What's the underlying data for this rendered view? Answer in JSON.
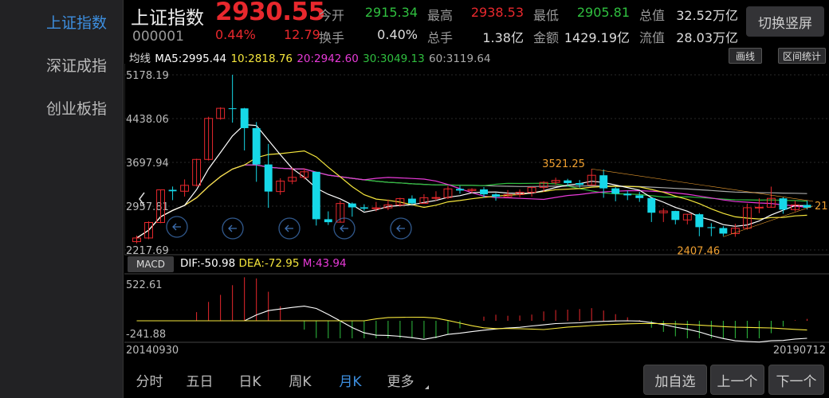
{
  "sidebar": {
    "items": [
      {
        "label": "上证指数",
        "active": true
      },
      {
        "label": "深证成指",
        "active": false
      },
      {
        "label": "创业板指",
        "active": false
      }
    ]
  },
  "header": {
    "name": "上证指数",
    "code": "000001",
    "price": "2930.55",
    "change_pct": "0.44%",
    "change_amt": "12.79",
    "quotes": [
      {
        "label": "今开",
        "value": "2915.34",
        "color": "#2fbf3f"
      },
      {
        "label": "最高",
        "value": "2938.53",
        "color": "#e8282d"
      },
      {
        "label": "最低",
        "value": "2905.81",
        "color": "#2fbf3f"
      },
      {
        "label": "总值",
        "value": "32.52万亿",
        "color": "#dddddd"
      },
      {
        "label": "换手",
        "value": "0.40%",
        "color": "#dddddd"
      },
      {
        "label": "总手",
        "value": "1.38亿",
        "color": "#dddddd"
      },
      {
        "label": "金额",
        "value": "1429.19亿",
        "color": "#dddddd"
      },
      {
        "label": "流值",
        "value": "28.03万亿",
        "color": "#dddddd"
      }
    ],
    "switch_label": "切换竖屏"
  },
  "ma_legend": {
    "title": "均线",
    "ma5": "MA5:2995.44",
    "ma10": "10:2818.76",
    "ma20": "20:2942.60",
    "ma30": "30:3049.13",
    "ma60": "60:3119.64"
  },
  "toolbar": {
    "draw_label": "画线",
    "range_label": "区间统计"
  },
  "colors": {
    "up": "#e8282d",
    "down": "#16d8e8",
    "ma5": "#ffffff",
    "ma10": "#f5e63c",
    "ma20": "#e83ad8",
    "ma30": "#2fbf3f",
    "ma60": "#aaaaaa",
    "accent": "#3d8fe0"
  },
  "chart_data": {
    "type": "candlestick",
    "period": "monthly",
    "y_ticks": [
      "5178.19",
      "4438.06",
      "3697.94",
      "2957.81",
      "2217.69"
    ],
    "ylim": [
      2217.69,
      5178.19
    ],
    "annotations": {
      "high_label": "3521.25",
      "low_label": "2407.46",
      "right_label": "21"
    },
    "candles": [
      [
        2358,
        2420,
        2330,
        2460
      ],
      [
        2420,
        2682,
        2400,
        2700
      ],
      [
        2682,
        3234,
        2670,
        3240
      ],
      [
        3234,
        3210,
        3060,
        3290
      ],
      [
        3210,
        3310,
        3120,
        3410
      ],
      [
        3310,
        3748,
        3290,
        3760
      ],
      [
        3748,
        4441,
        3730,
        4470
      ],
      [
        4441,
        4612,
        4420,
        4630
      ],
      [
        4612,
        4611,
        4370,
        5178
      ],
      [
        4611,
        4277,
        3900,
        4620
      ],
      [
        4277,
        3663,
        3370,
        4380
      ],
      [
        3663,
        3205,
        2930,
        4010
      ],
      [
        3205,
        3382,
        3150,
        3430
      ],
      [
        3382,
        3445,
        3330,
        3610
      ],
      [
        3445,
        3539,
        3410,
        3600
      ],
      [
        3539,
        2737,
        2630,
        3540
      ],
      [
        2737,
        2687,
        2640,
        2870
      ],
      [
        2687,
        3003,
        2680,
        3050
      ],
      [
        3003,
        2938,
        2780,
        3020
      ],
      [
        2938,
        2916,
        2880,
        2990
      ],
      [
        2916,
        2929,
        2870,
        3030
      ],
      [
        2929,
        2979,
        2890,
        3070
      ],
      [
        2979,
        3085,
        2950,
        3100
      ],
      [
        3085,
        3004,
        2990,
        3140
      ],
      [
        3004,
        3100,
        3000,
        3160
      ],
      [
        3100,
        3104,
        3050,
        3210
      ],
      [
        3104,
        3250,
        3080,
        3300
      ],
      [
        3250,
        3222,
        3170,
        3300
      ],
      [
        3222,
        3241,
        3180,
        3260
      ],
      [
        3241,
        3158,
        3100,
        3280
      ],
      [
        3158,
        3117,
        3050,
        3180
      ],
      [
        3117,
        3154,
        3110,
        3230
      ],
      [
        3154,
        3193,
        3110,
        3240
      ],
      [
        3193,
        3273,
        3120,
        3290
      ],
      [
        3273,
        3360,
        3200,
        3380
      ],
      [
        3360,
        3393,
        3320,
        3440
      ],
      [
        3393,
        3348,
        3300,
        3420
      ],
      [
        3348,
        3317,
        3270,
        3400
      ],
      [
        3317,
        3480,
        3310,
        3587
      ],
      [
        3480,
        3259,
        3100,
        3580
      ],
      [
        3259,
        3168,
        3040,
        3280
      ],
      [
        3168,
        3141,
        3060,
        3220
      ],
      [
        3141,
        3095,
        3030,
        3200
      ],
      [
        3095,
        2847,
        2690,
        3100
      ],
      [
        2847,
        2876,
        2690,
        2920
      ],
      [
        2876,
        2725,
        2650,
        2880
      ],
      [
        2725,
        2821,
        2650,
        2830
      ],
      [
        2821,
        2603,
        2450,
        2840
      ],
      [
        2603,
        2588,
        2450,
        2670
      ],
      [
        2588,
        2494,
        2450,
        2620
      ],
      [
        2494,
        2584,
        2440,
        2660
      ],
      [
        2584,
        2932,
        2560,
        3000
      ],
      [
        2932,
        2940,
        2840,
        3090
      ],
      [
        2940,
        3090,
        2930,
        3288
      ],
      [
        3090,
        2899,
        2830,
        3110
      ],
      [
        2899,
        2979,
        2870,
        3050
      ],
      [
        2979,
        2930,
        2900,
        3050
      ]
    ],
    "macd_ticks": [
      "522.61",
      "-241.88"
    ],
    "macd": {
      "dif": "DIF:-50.98",
      "dea": "DEA:-72.95",
      "m": "M:43.94"
    },
    "date_start": "20140930",
    "date_end": "20190712"
  },
  "macd_button": "MACD",
  "tabs": [
    {
      "label": "分时",
      "active": false
    },
    {
      "label": "五日",
      "active": false
    },
    {
      "label": "日K",
      "active": false
    },
    {
      "label": "周K",
      "active": false
    },
    {
      "label": "月K",
      "active": true
    },
    {
      "label": "更多",
      "active": false
    }
  ],
  "actions": {
    "add_label": "加自选",
    "prev_label": "上一个",
    "next_label": "下一个"
  }
}
